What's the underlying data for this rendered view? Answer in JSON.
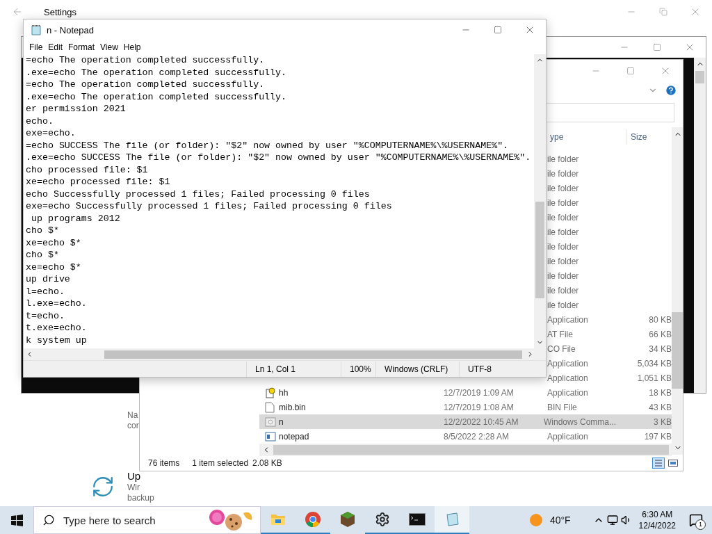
{
  "settings_window": {
    "title": "Settings",
    "texts": [
      "Na",
      "cor"
    ],
    "update": {
      "title": "Up",
      "lines": [
        "Wir",
        "backup"
      ]
    }
  },
  "explorer": {
    "columns": [
      "ype",
      "Size"
    ],
    "rows": [
      {
        "type": "ile folder",
        "selected": false
      },
      {
        "type": "ile folder",
        "selected": false
      },
      {
        "type": "ile folder",
        "selected": false
      },
      {
        "type": "ile folder",
        "selected": false
      },
      {
        "type": "ile folder",
        "selected": false
      },
      {
        "type": "ile folder",
        "selected": false
      },
      {
        "type": "ile folder",
        "selected": false
      },
      {
        "type": "ile folder",
        "selected": false
      },
      {
        "type": "ile folder",
        "selected": false
      },
      {
        "type": "ile folder",
        "selected": false
      },
      {
        "type": "ile folder",
        "selected": false
      },
      {
        "type": "Application",
        "size": "80 KB",
        "selected": false
      },
      {
        "type": "AT File",
        "size": "66 KB",
        "selected": false
      },
      {
        "type": "CO File",
        "size": "34 KB",
        "selected": false
      },
      {
        "type": "Application",
        "size": "5,034 KB",
        "selected": false
      },
      {
        "type": "Application",
        "size": "1,051 KB",
        "selected": false
      },
      {
        "kind": "help",
        "name": "hh",
        "modified": "12/7/2019 1:09 AM",
        "type": "Application",
        "size": "18 KB",
        "selected": false
      },
      {
        "kind": "file",
        "name": "mib.bin",
        "modified": "12/7/2019 1:08 AM",
        "type": "BIN File",
        "size": "43 KB",
        "selected": false
      },
      {
        "kind": "script",
        "name": "n",
        "modified": "12/2/2022 10:45 AM",
        "type": "Windows Comma...",
        "size": "3 KB",
        "selected": true
      },
      {
        "kind": "app",
        "name": "notepad",
        "modified": "8/5/2022 2:28 AM",
        "type": "Application",
        "size": "197 KB",
        "selected": false
      }
    ],
    "status_count": "76 items",
    "status_selection": "1 item selected",
    "status_size": "2.08 KB"
  },
  "notepad": {
    "title": "n - Notepad",
    "menu": [
      "File",
      "Edit",
      "Format",
      "View",
      "Help"
    ],
    "lines": [
      "=echo The operation completed successfully.",
      ".exe=echo The operation completed successfully.",
      "=echo The operation completed successfully.",
      ".exe=echo The operation completed successfully.",
      "er permission 2021",
      "echo.",
      "exe=echo.",
      "=echo SUCCESS The file (or folder): \"$2\" now owned by user \"%COMPUTERNAME%\\%USERNAME%\".",
      ".exe=echo SUCCESS The file (or folder): \"$2\" now owned by user \"%COMPUTERNAME%\\%USERNAME%\".",
      "cho processed file: $1",
      "xe=echo processed file: $1",
      "echo Successfully processed 1 files; Failed processing 0 files",
      "exe=echo Successfully processed 1 files; Failed processing 0 files",
      " up programs 2012",
      "cho $*",
      "xe=echo $*",
      "cho $*",
      "xe=echo $*",
      "up drive",
      "l=echo.",
      "l.exe=echo.",
      "t=echo.",
      "t.exe=echo.",
      "k system up"
    ],
    "status": [
      "Ln 1, Col 1",
      "100%",
      "Windows (CRLF)",
      "UTF-8"
    ]
  },
  "taskbar": {
    "search": {
      "placeholder": "Type here to search"
    },
    "apps": [
      {
        "kind": "explorer",
        "running": true,
        "selected": false
      },
      {
        "kind": "chrome",
        "running": true,
        "selected": false
      },
      {
        "kind": "block",
        "running": false,
        "selected": false
      },
      {
        "kind": "settings",
        "running": true,
        "selected": false
      },
      {
        "kind": "console",
        "running": true,
        "selected": false
      },
      {
        "kind": "notepad",
        "running": true,
        "selected": true
      }
    ],
    "weather": "40°F",
    "time": "6:30 AM",
    "date": "12/4/2022",
    "notification_count": "1"
  }
}
